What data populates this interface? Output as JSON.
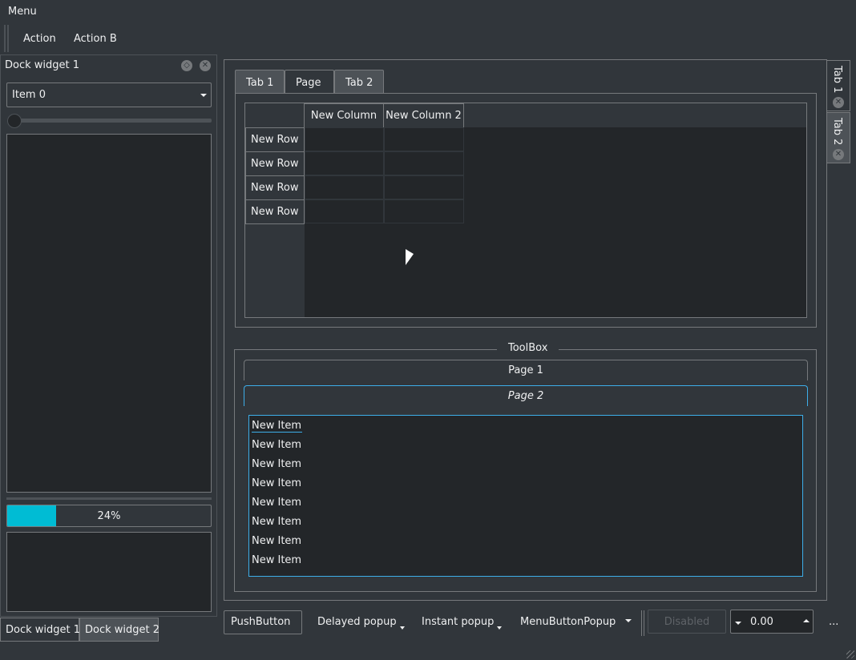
{
  "menubar": {
    "menu": "Menu"
  },
  "toolbar": {
    "action": "Action",
    "action_b": "Action B"
  },
  "dock": {
    "title": "Dock widget 1",
    "combo_value": "Item 0",
    "progress_text": "24%",
    "progress_fraction": 0.24,
    "progress_color": "#00bcd4"
  },
  "bottom_tabs": [
    "Dock widget 1",
    "Dock widget 2"
  ],
  "tabs": [
    "Tab 1",
    "Page",
    "Tab 2"
  ],
  "table": {
    "columns": [
      "New Column",
      "New Column 2"
    ],
    "rows": [
      "New Row",
      "New Row",
      "New Row",
      "New Row"
    ]
  },
  "toolbox": {
    "title": "ToolBox",
    "pages": [
      "Page 1",
      "Page 2"
    ],
    "items": [
      "New Item",
      "New Item",
      "New Item",
      "New Item",
      "New Item",
      "New Item",
      "New Item",
      "New Item"
    ]
  },
  "side_tabs": [
    "Tab 1",
    "Tab 2"
  ],
  "bottom_bar": {
    "push": "PushButton",
    "delayed": "Delayed popup",
    "instant": "Instant popup",
    "menu_popup": "MenuButtonPopup",
    "disabled": "Disabled",
    "spin_value": "0.00",
    "more": "..."
  },
  "colors": {
    "accent": "#3daee9",
    "background": "#31363b",
    "view": "#232629"
  }
}
